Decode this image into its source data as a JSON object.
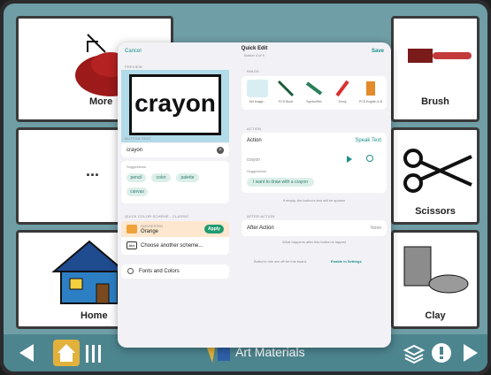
{
  "board": {
    "tiles": [
      {
        "label": "More"
      },
      {
        "label": "Brush"
      },
      {
        "label": ""
      },
      {
        "label": "Scissors"
      },
      {
        "label": "Home"
      },
      {
        "label": "Clay"
      }
    ],
    "ellipsis": "..."
  },
  "bottom_bar": {
    "title": "Art Materials"
  },
  "modal": {
    "cancel": "Cancel",
    "title": "Quick Edit",
    "subtitle": "Button 4 of 9",
    "save": "Save",
    "preview_label": "PREVIEW",
    "preview_word": "crayon",
    "button_text_label": "BUTTON TEXT",
    "button_text_value": "crayon",
    "suggestions_label": "Suggestions",
    "suggestions": [
      "pencil",
      "color",
      "palette",
      "canvas"
    ],
    "color_scheme_label": "QUICK COLOR SCHEME - CLASSIC",
    "suggested_label": "SUGGESTED",
    "suggested_value": "Orange",
    "apply": "Apply",
    "choose_scheme": "Choose another scheme...",
    "fonts_colors": "Fonts and Colors",
    "image_label": "IMAGE",
    "images": [
      "Set image...",
      "PCS Book",
      "SymbolStix",
      "Emoji",
      "PCS English & B"
    ],
    "action_label": "ACTION",
    "action_name": "Action",
    "action_value": "Speak Text",
    "action_input": "crayon",
    "action_suggestions_label": "Suggestions",
    "action_suggestion": "I want to draw with a crayon",
    "action_note": "If empty, the button's text will be spoken",
    "after_action_label": "AFTER ACTION",
    "after_action_name": "After Action",
    "after_action_value": "None",
    "after_action_note": "What happens after this button is tapped",
    "settings_note": "Button's role are off for this board.",
    "settings_link": "Enable in Settings"
  },
  "colors": {
    "teal": "#1a8f8a",
    "board_bg": "#6f9ea6",
    "bar": "#4d858f",
    "home": "#e2b13c",
    "apply_green": "#1f9b6f",
    "orange": "#f0a13a"
  }
}
